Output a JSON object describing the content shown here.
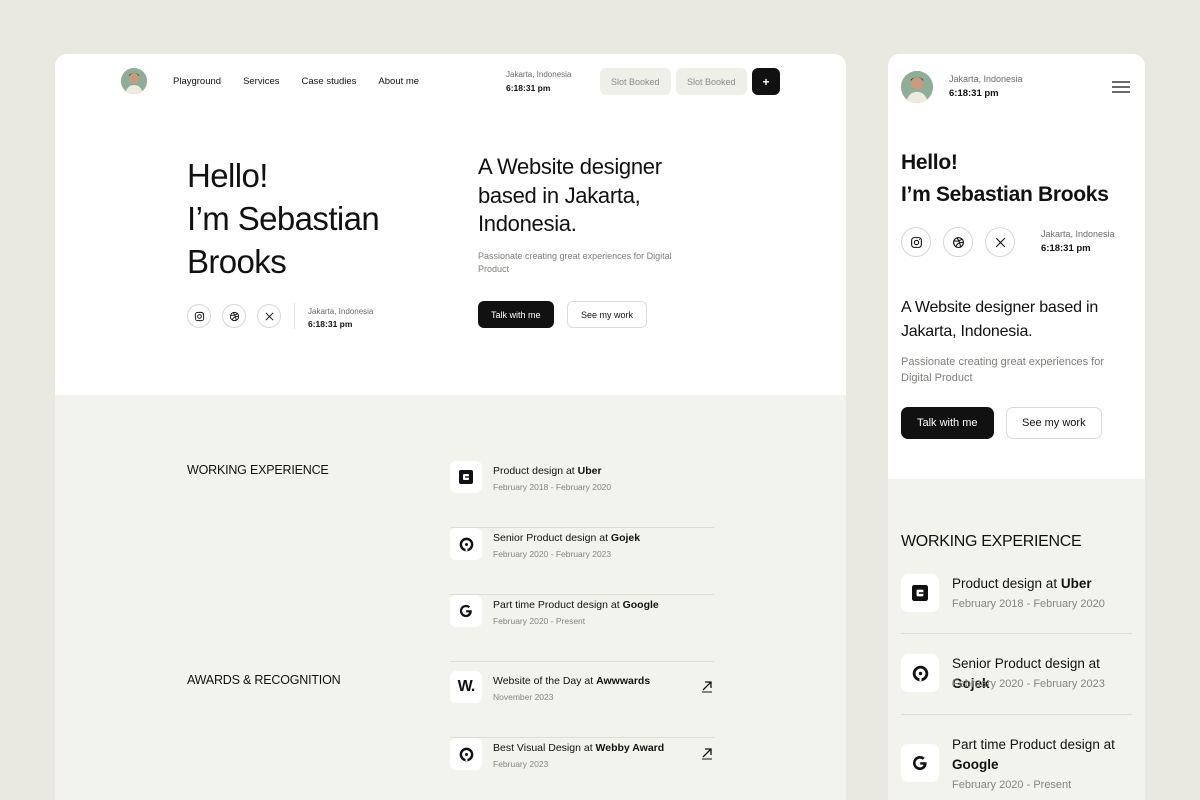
{
  "nav": {
    "links": [
      "Playground",
      "Services",
      "Case studies",
      "About me"
    ],
    "location_city": "Jakarta, Indonesia",
    "location_time": "6:18:31 pm",
    "slot_1": "Slot Booked",
    "slot_2": "Slot Booked",
    "plus_label": "+"
  },
  "hero": {
    "hello_line1": "Hello!",
    "hello_line2": "I’m Sebastian Brooks",
    "location_city": "Jakarta, Indonesia",
    "location_time": "6:18:31 pm",
    "tagline": "A Website designer based in Jakarta, Indonesia.",
    "subtext": "Passionate creating great experiences for Digital Product",
    "talk_button": "Talk with me",
    "work_button": "See my work"
  },
  "experience": {
    "title": "WORKING EXPERIENCE",
    "items": [
      {
        "prefix": "Product design at ",
        "company": "Uber",
        "dates": "February 2018 - February 2020",
        "logo": "uber-icon"
      },
      {
        "prefix": "Senior Product design at ",
        "company": "Gojek",
        "dates": "February 2020 - February 2023",
        "logo": "gojek-icon"
      },
      {
        "prefix": "Part time Product design at ",
        "company": "Google",
        "dates": "February 2020 - Present",
        "logo": "google-icon"
      }
    ]
  },
  "awards": {
    "title": "AWARDS & RECOGNITION",
    "items": [
      {
        "prefix": "Website of the Day at ",
        "company": "Awwwards",
        "dates": "November 2023",
        "logo": "awwwards-icon"
      },
      {
        "prefix": "Best Visual Design at ",
        "company": "Webby Award",
        "dates": "February 2023",
        "logo": "webby-icon"
      }
    ]
  },
  "mobile": {
    "location_city": "Jakarta, Indonesia",
    "location_time": "6:18:31 pm",
    "hello_line1": "Hello!",
    "hello_line2": "I’m Sebastian Brooks",
    "hero_location_city": "Jakarta, Indonesia",
    "hero_location_time": "6:18:31 pm",
    "tagline": "A Website designer based in Jakarta, Indonesia.",
    "subtext": "Passionate creating great experiences for Digital Product",
    "talk_button": "Talk with me",
    "work_button": "See my work",
    "experience_title": "WORKING EXPERIENCE",
    "experience": [
      {
        "prefix": "Product design at ",
        "company": "Uber",
        "dates": "February 2018 - February 2020"
      },
      {
        "prefix": "Senior Product design at ",
        "company": "Gojek",
        "dates": "February 2020 - February 2023"
      },
      {
        "prefix": "Part time Product design at ",
        "company": "Google",
        "dates": "February 2020 - Present"
      }
    ]
  },
  "colors": {
    "page_bg": "#e9e9e2",
    "section_bg": "#f3f3ee",
    "card_bg": "#ffffff",
    "primary": "#111111",
    "muted_text": "#7d7d78"
  }
}
